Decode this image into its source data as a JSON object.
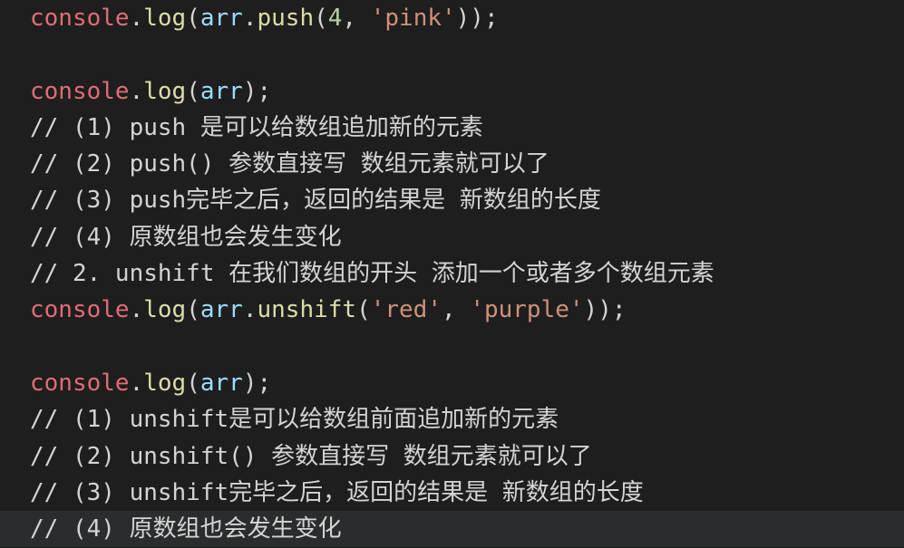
{
  "editor": {
    "lines": [
      {
        "kind": "code",
        "parts": [
          {
            "cls": "ident-console",
            "text": "console"
          },
          {
            "cls": "punc",
            "text": "."
          },
          {
            "cls": "fn",
            "text": "log"
          },
          {
            "cls": "punc",
            "text": "("
          },
          {
            "cls": "var",
            "text": "arr"
          },
          {
            "cls": "punc",
            "text": "."
          },
          {
            "cls": "fn",
            "text": "push"
          },
          {
            "cls": "punc",
            "text": "("
          },
          {
            "cls": "num",
            "text": "4"
          },
          {
            "cls": "punc",
            "text": ", "
          },
          {
            "cls": "str",
            "text": "'pink'"
          },
          {
            "cls": "punc",
            "text": "));"
          }
        ]
      },
      {
        "kind": "blank",
        "parts": []
      },
      {
        "kind": "code",
        "parts": [
          {
            "cls": "ident-console",
            "text": "console"
          },
          {
            "cls": "punc",
            "text": "."
          },
          {
            "cls": "fn",
            "text": "log"
          },
          {
            "cls": "punc",
            "text": "("
          },
          {
            "cls": "var",
            "text": "arr"
          },
          {
            "cls": "punc",
            "text": ");"
          }
        ]
      },
      {
        "kind": "comment",
        "parts": [
          {
            "cls": "comment",
            "text": "// (1) push 是可以给数组追加新的元素"
          }
        ]
      },
      {
        "kind": "comment",
        "parts": [
          {
            "cls": "comment",
            "text": "// (2) push() 参数直接写 数组元素就可以了"
          }
        ]
      },
      {
        "kind": "comment",
        "parts": [
          {
            "cls": "comment",
            "text": "// (3) push完毕之后，返回的结果是 新数组的长度"
          }
        ]
      },
      {
        "kind": "comment",
        "parts": [
          {
            "cls": "comment",
            "text": "// (4) 原数组也会发生变化"
          }
        ]
      },
      {
        "kind": "comment",
        "parts": [
          {
            "cls": "comment",
            "text": "// 2. unshift 在我们数组的开头 添加一个或者多个数组元素"
          }
        ]
      },
      {
        "kind": "code",
        "parts": [
          {
            "cls": "ident-console",
            "text": "console"
          },
          {
            "cls": "punc",
            "text": "."
          },
          {
            "cls": "fn",
            "text": "log"
          },
          {
            "cls": "punc",
            "text": "("
          },
          {
            "cls": "var",
            "text": "arr"
          },
          {
            "cls": "punc",
            "text": "."
          },
          {
            "cls": "fn",
            "text": "unshift"
          },
          {
            "cls": "punc",
            "text": "("
          },
          {
            "cls": "str",
            "text": "'red'"
          },
          {
            "cls": "punc",
            "text": ", "
          },
          {
            "cls": "str",
            "text": "'purple'"
          },
          {
            "cls": "punc",
            "text": "));"
          }
        ]
      },
      {
        "kind": "blank",
        "parts": []
      },
      {
        "kind": "code",
        "parts": [
          {
            "cls": "ident-console",
            "text": "console"
          },
          {
            "cls": "punc",
            "text": "."
          },
          {
            "cls": "fn",
            "text": "log"
          },
          {
            "cls": "punc",
            "text": "("
          },
          {
            "cls": "var",
            "text": "arr"
          },
          {
            "cls": "punc",
            "text": ");"
          }
        ]
      },
      {
        "kind": "comment",
        "parts": [
          {
            "cls": "comment",
            "text": "// (1) unshift是可以给数组前面追加新的元素"
          }
        ]
      },
      {
        "kind": "comment",
        "parts": [
          {
            "cls": "comment",
            "text": "// (2) unshift() 参数直接写 数组元素就可以了"
          }
        ]
      },
      {
        "kind": "comment",
        "parts": [
          {
            "cls": "comment",
            "text": "// (3) unshift完毕之后，返回的结果是 新数组的长度"
          }
        ]
      },
      {
        "kind": "comment",
        "current": true,
        "parts": [
          {
            "cls": "comment",
            "text": "// (4) 原数组也会发生变化"
          }
        ]
      }
    ]
  }
}
